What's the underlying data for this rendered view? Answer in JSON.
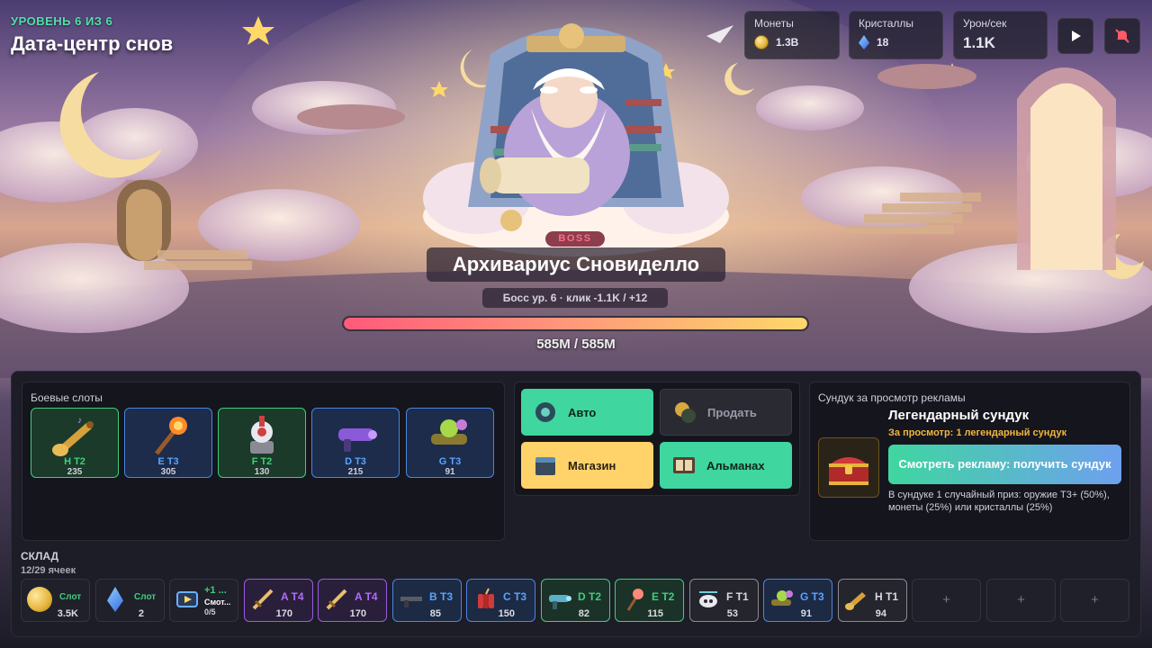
{
  "hud": {
    "level": "УРОВЕНЬ 6 ИЗ 6",
    "zone": "Дата-центр снов",
    "coins_label": "Монеты",
    "coins_value": "1.3B",
    "crystals_label": "Кристаллы",
    "crystals_value": "18",
    "dps_label": "Урон/сек",
    "dps_value": "1.1K",
    "play_icon": "play-icon",
    "mute_icon": "mute-icon"
  },
  "boss": {
    "badge": "BOSS",
    "name": "Архивариус Сновиделло",
    "info": "Босс ур. 6 · клик -1.1K / +12",
    "hp_text": "585M / 585M",
    "hp_fraction": 1.0
  },
  "combat": {
    "title": "Боевые слоты",
    "slots": [
      {
        "tier": "H T2",
        "count": "235",
        "icon": "trumpet-icon",
        "color": "#3ecf7a"
      },
      {
        "tier": "E T3",
        "count": "305",
        "icon": "fire-staff-icon",
        "color": "#5aa3ff"
      },
      {
        "tier": "F T2",
        "count": "130",
        "icon": "turret-icon",
        "color": "#3ecf7a"
      },
      {
        "tier": "D T3",
        "count": "215",
        "icon": "blaster-icon",
        "color": "#5aa3ff"
      },
      {
        "tier": "G T3",
        "count": "91",
        "icon": "potion-launcher-icon",
        "color": "#5aa3ff"
      }
    ]
  },
  "actions": {
    "auto": "Авто",
    "sell": "Продать",
    "shop": "Магазин",
    "almanac": "Альманах"
  },
  "chest": {
    "panel_title": "Сундук за просмотр рекламы",
    "title": "Легендарный сундук",
    "subtitle": "За просмотр: 1 легендарный сундук",
    "button": "Смотреть рекламу: получить сундук",
    "description": "В сундуке 1 случайный приз: оружие Т3+ (50%), монеты (25%) или кристаллы (25%)"
  },
  "storage": {
    "title": "СКЛАД",
    "capacity": "12/29 ячеек",
    "items": [
      {
        "label": "Слот",
        "count": "3.5K",
        "icon": "coin-icon",
        "color": "#3ecf7a"
      },
      {
        "label": "Слот",
        "count": "2",
        "icon": "crystal-icon",
        "color": "#3ecf7a"
      },
      {
        "label": "+1 ...",
        "sublabel": "Смот...",
        "count": "0/5",
        "icon": "video-ad-icon",
        "color": "#3ecf7a"
      },
      {
        "label": "A T4",
        "count": "170",
        "icon": "sword-icon",
        "color": "#b06cff"
      },
      {
        "label": "A T4",
        "count": "170",
        "icon": "sword-icon",
        "color": "#b06cff"
      },
      {
        "label": "B T3",
        "count": "85",
        "icon": "rifle-icon",
        "color": "#5aa3ff"
      },
      {
        "label": "C T3",
        "count": "150",
        "icon": "dynamite-icon",
        "color": "#5aa3ff"
      },
      {
        "label": "D T2",
        "count": "82",
        "icon": "blaster-icon",
        "color": "#3ecf7a"
      },
      {
        "label": "E T2",
        "count": "115",
        "icon": "fire-staff-icon",
        "color": "#3ecf7a"
      },
      {
        "label": "F T1",
        "count": "53",
        "icon": "drone-icon",
        "color": "#d8d8e0"
      },
      {
        "label": "G T3",
        "count": "91",
        "icon": "potion-launcher-icon",
        "color": "#5aa3ff"
      },
      {
        "label": "H T1",
        "count": "94",
        "icon": "trumpet-icon",
        "color": "#d8d8e0"
      }
    ],
    "empty_label": "+"
  }
}
